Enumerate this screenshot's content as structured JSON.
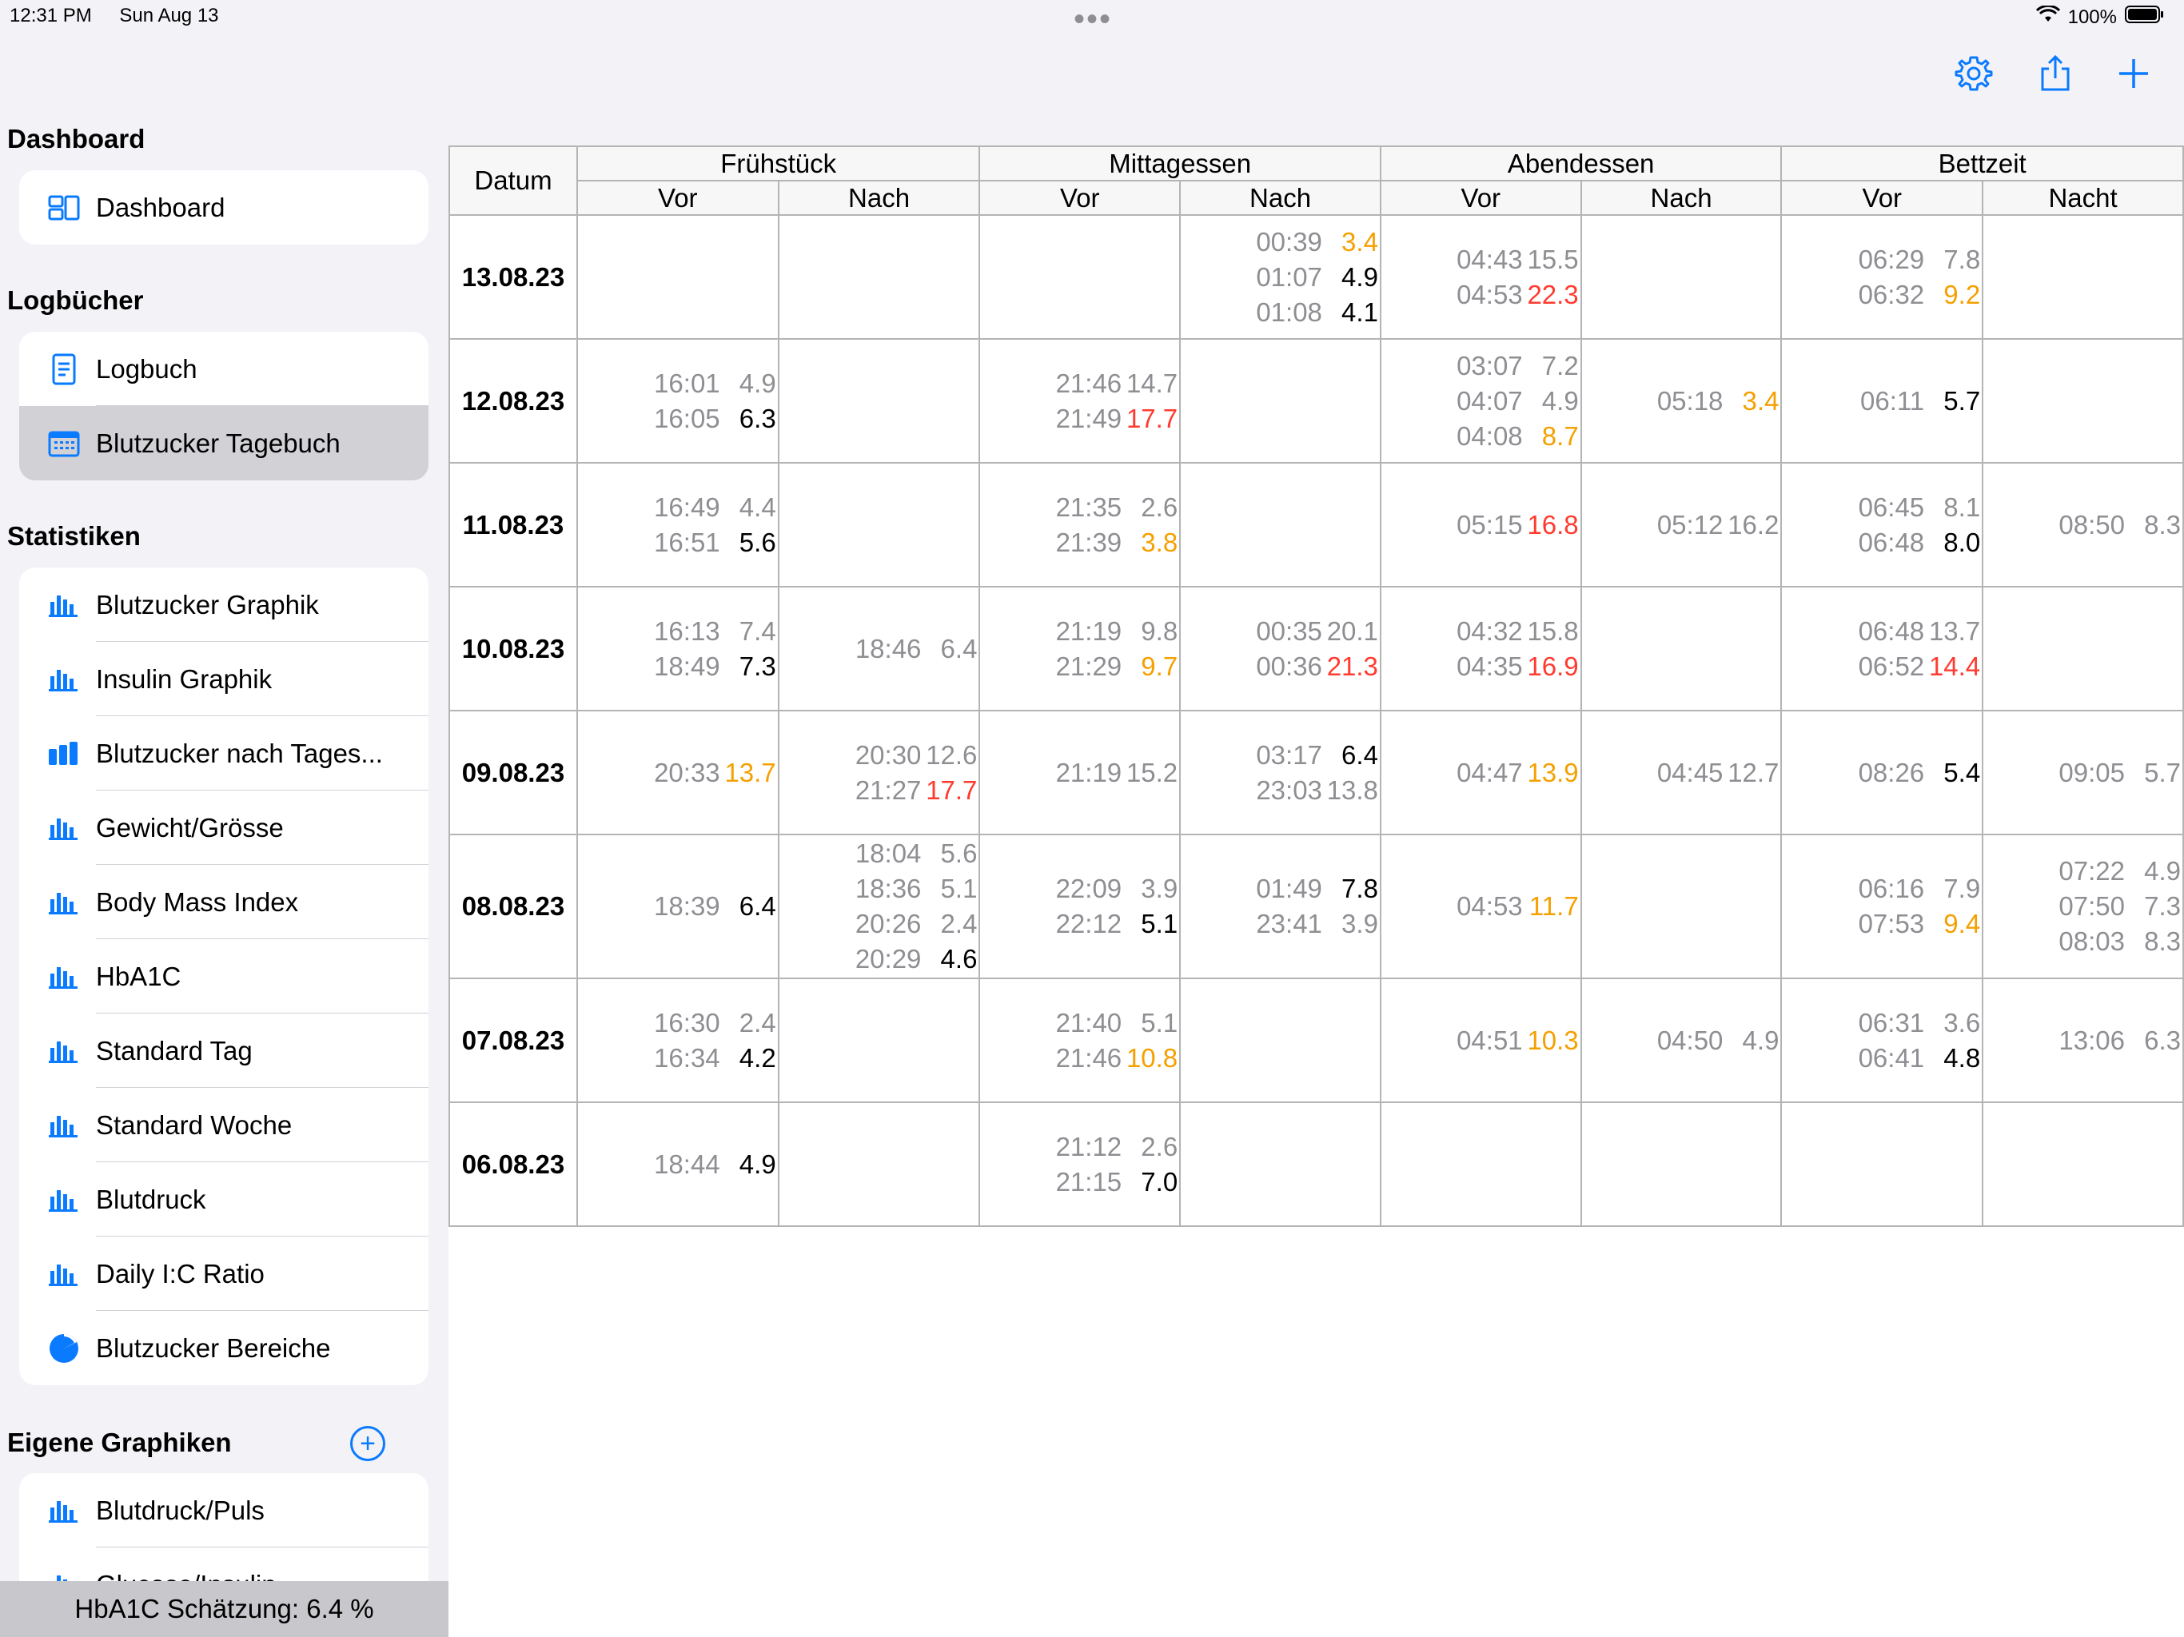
{
  "status": {
    "time": "12:31 PM",
    "date": "Sun Aug 13",
    "battery": "100%"
  },
  "colors": {
    "accent": "#0a7aff",
    "low_grey": "#8e8e93",
    "normal": "#000000",
    "high": "#f5a000",
    "very_high": "#ff3b30"
  },
  "sidebar": {
    "dashboard_header": "Dashboard",
    "dashboard_item": {
      "label": "Dashboard",
      "icon": "dashboard-icon"
    },
    "logbooks_header": "Logbücher",
    "logbooks": [
      {
        "label": "Logbuch",
        "icon": "document-icon"
      },
      {
        "label": "Blutzucker Tagebuch",
        "icon": "calendar-icon",
        "selected": true
      }
    ],
    "stats_header": "Statistiken",
    "stats": [
      {
        "label": "Blutzucker Graphik",
        "icon": "bar-chart-icon"
      },
      {
        "label": "Insulin Graphik",
        "icon": "bar-chart-icon"
      },
      {
        "label": "Blutzucker nach Tages...",
        "icon": "bar-chart-filled-icon"
      },
      {
        "label": "Gewicht/Grösse",
        "icon": "bar-chart-icon"
      },
      {
        "label": "Body Mass Index",
        "icon": "bar-chart-icon"
      },
      {
        "label": "HbA1C",
        "icon": "bar-chart-icon"
      },
      {
        "label": "Standard Tag",
        "icon": "bar-chart-icon"
      },
      {
        "label": "Standard Woche",
        "icon": "bar-chart-icon"
      },
      {
        "label": "Blutdruck",
        "icon": "bar-chart-icon"
      },
      {
        "label": "Daily I:C Ratio",
        "icon": "bar-chart-icon"
      },
      {
        "label": "Blutzucker Bereiche",
        "icon": "pie-chart-icon"
      }
    ],
    "custom_header": "Eigene Graphiken",
    "custom": [
      {
        "label": "Blutdruck/Puls",
        "icon": "bar-chart-icon"
      },
      {
        "label": "Glucose/Insulin",
        "icon": "bar-chart-icon"
      }
    ],
    "hba1c": "HbA1C Schätzung: 6.4 %"
  },
  "toolbar": {
    "settings_icon": "gear-icon",
    "share_icon": "share-icon",
    "add_icon": "plus-icon"
  },
  "table": {
    "datum_label": "Datum",
    "groups": [
      "Frühstück",
      "Mittagessen",
      "Abendessen",
      "Bettzeit"
    ],
    "subcols": [
      "Vor",
      "Nach",
      "Vor",
      "Nach",
      "Vor",
      "Nach",
      "Vor",
      "Nacht"
    ],
    "rows": [
      {
        "date": "13.08.23",
        "cells": [
          [],
          [],
          [],
          [
            {
              "t": "00:39",
              "v": "3.4",
              "c": "orange"
            },
            {
              "t": "01:07",
              "v": "4.9",
              "c": "black"
            },
            {
              "t": "01:08",
              "v": "4.1",
              "c": "black"
            }
          ],
          [
            {
              "t": "04:43",
              "v": "15.5",
              "c": "gray"
            },
            {
              "t": "04:53",
              "v": "22.3",
              "c": "red"
            }
          ],
          [],
          [
            {
              "t": "06:29",
              "v": "7.8",
              "c": "gray"
            },
            {
              "t": "06:32",
              "v": "9.2",
              "c": "orange"
            }
          ],
          []
        ]
      },
      {
        "date": "12.08.23",
        "cells": [
          [
            {
              "t": "16:01",
              "v": "4.9",
              "c": "gray"
            },
            {
              "t": "16:05",
              "v": "6.3",
              "c": "black"
            }
          ],
          [],
          [
            {
              "t": "21:46",
              "v": "14.7",
              "c": "gray"
            },
            {
              "t": "21:49",
              "v": "17.7",
              "c": "red"
            }
          ],
          [],
          [
            {
              "t": "03:07",
              "v": "7.2",
              "c": "gray"
            },
            {
              "t": "04:07",
              "v": "4.9",
              "c": "gray"
            },
            {
              "t": "04:08",
              "v": "8.7",
              "c": "orange"
            }
          ],
          [
            {
              "t": "05:18",
              "v": "3.4",
              "c": "orange"
            }
          ],
          [
            {
              "t": "06:11",
              "v": "5.7",
              "c": "black"
            }
          ],
          []
        ]
      },
      {
        "date": "11.08.23",
        "cells": [
          [
            {
              "t": "16:49",
              "v": "4.4",
              "c": "gray"
            },
            {
              "t": "16:51",
              "v": "5.6",
              "c": "black"
            }
          ],
          [],
          [
            {
              "t": "21:35",
              "v": "2.6",
              "c": "gray"
            },
            {
              "t": "21:39",
              "v": "3.8",
              "c": "orange"
            }
          ],
          [],
          [
            {
              "t": "05:15",
              "v": "16.8",
              "c": "red"
            }
          ],
          [
            {
              "t": "05:12",
              "v": "16.2",
              "c": "gray"
            }
          ],
          [
            {
              "t": "06:45",
              "v": "8.1",
              "c": "gray"
            },
            {
              "t": "06:48",
              "v": "8.0",
              "c": "black"
            }
          ],
          [
            {
              "t": "08:50",
              "v": "8.3",
              "c": "gray"
            }
          ]
        ]
      },
      {
        "date": "10.08.23",
        "cells": [
          [
            {
              "t": "16:13",
              "v": "7.4",
              "c": "gray"
            },
            {
              "t": "18:49",
              "v": "7.3",
              "c": "black"
            }
          ],
          [
            {
              "t": "18:46",
              "v": "6.4",
              "c": "gray"
            }
          ],
          [
            {
              "t": "21:19",
              "v": "9.8",
              "c": "gray"
            },
            {
              "t": "21:29",
              "v": "9.7",
              "c": "orange"
            }
          ],
          [
            {
              "t": "00:35",
              "v": "20.1",
              "c": "gray"
            },
            {
              "t": "00:36",
              "v": "21.3",
              "c": "red"
            }
          ],
          [
            {
              "t": "04:32",
              "v": "15.8",
              "c": "gray"
            },
            {
              "t": "04:35",
              "v": "16.9",
              "c": "red"
            }
          ],
          [],
          [
            {
              "t": "06:48",
              "v": "13.7",
              "c": "gray"
            },
            {
              "t": "06:52",
              "v": "14.4",
              "c": "red"
            }
          ],
          []
        ]
      },
      {
        "date": "09.08.23",
        "cells": [
          [
            {
              "t": "20:33",
              "v": "13.7",
              "c": "orange"
            }
          ],
          [
            {
              "t": "20:30",
              "v": "12.6",
              "c": "gray"
            },
            {
              "t": "21:27",
              "v": "17.7",
              "c": "red"
            }
          ],
          [
            {
              "t": "21:19",
              "v": "15.2",
              "c": "gray"
            }
          ],
          [
            {
              "t": "03:17",
              "v": "6.4",
              "c": "black"
            },
            {
              "t": "23:03",
              "v": "13.8",
              "c": "gray"
            }
          ],
          [
            {
              "t": "04:47",
              "v": "13.9",
              "c": "orange"
            }
          ],
          [
            {
              "t": "04:45",
              "v": "12.7",
              "c": "gray"
            }
          ],
          [
            {
              "t": "08:26",
              "v": "5.4",
              "c": "black"
            }
          ],
          [
            {
              "t": "09:05",
              "v": "5.7",
              "c": "gray"
            }
          ]
        ]
      },
      {
        "date": "08.08.23",
        "cells": [
          [
            {
              "t": "18:39",
              "v": "6.4",
              "c": "black"
            }
          ],
          [
            {
              "t": "18:04",
              "v": "5.6",
              "c": "gray"
            },
            {
              "t": "18:36",
              "v": "5.1",
              "c": "gray"
            },
            {
              "t": "20:26",
              "v": "2.4",
              "c": "gray"
            },
            {
              "t": "20:29",
              "v": "4.6",
              "c": "black"
            }
          ],
          [
            {
              "t": "22:09",
              "v": "3.9",
              "c": "gray"
            },
            {
              "t": "22:12",
              "v": "5.1",
              "c": "black"
            }
          ],
          [
            {
              "t": "01:49",
              "v": "7.8",
              "c": "black"
            },
            {
              "t": "23:41",
              "v": "3.9",
              "c": "gray"
            }
          ],
          [
            {
              "t": "04:53",
              "v": "11.7",
              "c": "orange"
            }
          ],
          [],
          [
            {
              "t": "06:16",
              "v": "7.9",
              "c": "gray"
            },
            {
              "t": "07:53",
              "v": "9.4",
              "c": "orange"
            }
          ],
          [
            {
              "t": "07:22",
              "v": "4.9",
              "c": "gray"
            },
            {
              "t": "07:50",
              "v": "7.3",
              "c": "gray"
            },
            {
              "t": "08:03",
              "v": "8.3",
              "c": "gray"
            }
          ]
        ]
      },
      {
        "date": "07.08.23",
        "cells": [
          [
            {
              "t": "16:30",
              "v": "2.4",
              "c": "gray"
            },
            {
              "t": "16:34",
              "v": "4.2",
              "c": "black"
            }
          ],
          [],
          [
            {
              "t": "21:40",
              "v": "5.1",
              "c": "gray"
            },
            {
              "t": "21:46",
              "v": "10.8",
              "c": "orange"
            }
          ],
          [],
          [
            {
              "t": "04:51",
              "v": "10.3",
              "c": "orange"
            }
          ],
          [
            {
              "t": "04:50",
              "v": "4.9",
              "c": "gray"
            }
          ],
          [
            {
              "t": "06:31",
              "v": "3.6",
              "c": "gray"
            },
            {
              "t": "06:41",
              "v": "4.8",
              "c": "black"
            }
          ],
          [
            {
              "t": "13:06",
              "v": "6.3",
              "c": "gray"
            }
          ]
        ]
      },
      {
        "date": "06.08.23",
        "cells": [
          [
            {
              "t": "18:44",
              "v": "4.9",
              "c": "black"
            }
          ],
          [],
          [
            {
              "t": "21:12",
              "v": "2.6",
              "c": "gray"
            },
            {
              "t": "21:15",
              "v": "7.0",
              "c": "black"
            }
          ],
          [],
          [],
          [],
          [],
          []
        ]
      }
    ]
  }
}
